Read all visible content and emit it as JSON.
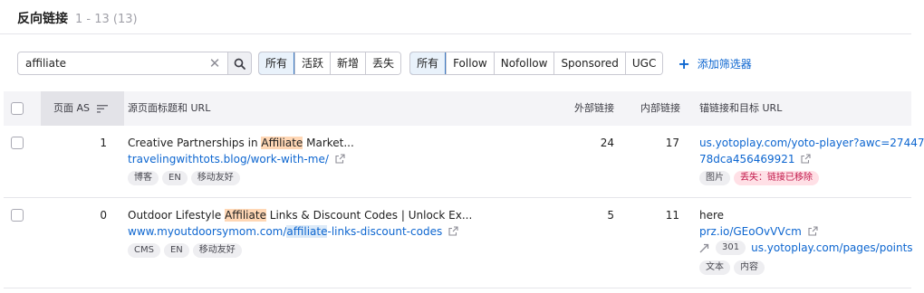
{
  "header": {
    "title": "反向链接",
    "count": "1 - 13 (13)"
  },
  "search": {
    "value": "affiliate"
  },
  "filters": {
    "status": [
      "所有",
      "活跃",
      "新增",
      "丢失"
    ],
    "type": [
      "所有",
      "Follow",
      "Nofollow",
      "Sponsored",
      "UGC"
    ],
    "add_label": "添加筛选器"
  },
  "table": {
    "headers": {
      "page_as": "页面 AS",
      "source": "源页面标题和 URL",
      "external": "外部链接",
      "internal": "内部链接",
      "anchor": "锚链接和目标 URL"
    },
    "rows": [
      {
        "as": "1",
        "title_pre": "Creative Partnerships in ",
        "title_hl": "Affiliate",
        "title_post": " Market...",
        "url": "travelingwithtots.blog/work-with-me/",
        "tags": [
          "博客",
          "EN",
          "移动友好"
        ],
        "external": "24",
        "internal": "17",
        "anchor_line1": "us.yotoplay.com/yoto-player?awc=27447",
        "anchor_line2": "78dca456469921",
        "anchor_tags": [
          "图片"
        ],
        "lost_tag": "丢失：链接已移除"
      },
      {
        "as": "0",
        "title_pre": "Outdoor Lifestyle ",
        "title_hl": "Affiliate",
        "title_post": " Links & Discount Codes | Unlock Ex...",
        "url_pre": "www.myoutdoorsymom.com/",
        "url_hl": "affiliate",
        "url_post": "-links-discount-codes",
        "tags": [
          "CMS",
          "EN",
          "移动友好"
        ],
        "external": "5",
        "internal": "11",
        "anchor_text": "here",
        "anchor_link": "prz.io/GEoOvVVcm",
        "redirect_code": "301",
        "redirect_target": "us.yotoplay.com/pages/points",
        "anchor_tags": [
          "文本",
          "内容"
        ]
      }
    ]
  }
}
